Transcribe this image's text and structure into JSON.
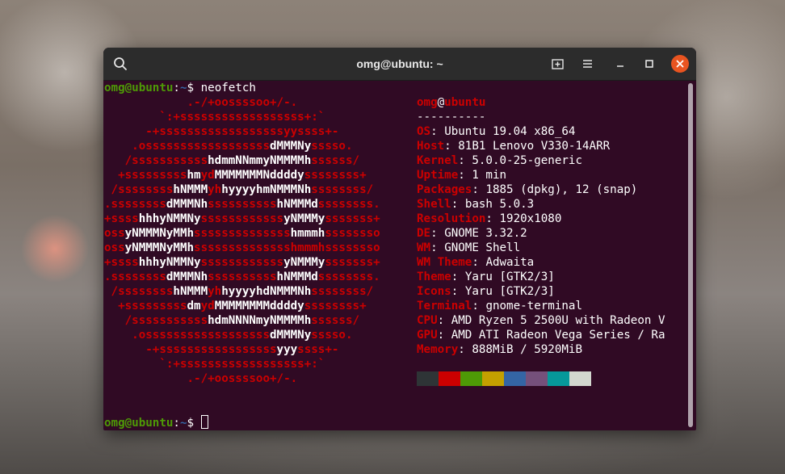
{
  "window": {
    "title": "omg@ubuntu: ~"
  },
  "colors": {
    "terminal_bg": "#300a24",
    "red": "#cc0000",
    "green": "#4e9a06",
    "blue": "#3465a4",
    "close_button": "#e95420"
  },
  "icons": {
    "search": "search-icon",
    "new_tab": "new-tab-icon",
    "menu": "hamburger-menu-icon",
    "minimize": "minimize-icon",
    "maximize": "maximize-icon",
    "close": "close-icon"
  },
  "terminal": {
    "prompt_user": "omg@ubuntu",
    "prompt_sep": ":",
    "prompt_path": "~",
    "prompt_sign": "$ ",
    "command": "neofetch",
    "ascii_art": [
      [
        [
          "r",
          "            .-/+oossssoo+/-."
        ]
      ],
      [
        [
          "r",
          "        `:+ssssssssssssssssss+:`"
        ]
      ],
      [
        [
          "r",
          "      -+ssssssssssssssssssyyssss+-"
        ]
      ],
      [
        [
          "r",
          "    .ossssssssssssssssss"
        ],
        [
          "w",
          "dMMMNy"
        ],
        [
          "r",
          "sssso."
        ]
      ],
      [
        [
          "r",
          "   /sssssssssss"
        ],
        [
          "w",
          "hdmmNNmmyNMMMMh"
        ],
        [
          "r",
          "ssssss/"
        ]
      ],
      [
        [
          "r",
          "  +sssssssss"
        ],
        [
          "w",
          "hm"
        ],
        [
          "r",
          "yd"
        ],
        [
          "w",
          "MMMMMMMNddddy"
        ],
        [
          "r",
          "ssssssss+"
        ]
      ],
      [
        [
          "r",
          " /ssssssss"
        ],
        [
          "w",
          "hNMMM"
        ],
        [
          "r",
          "yh"
        ],
        [
          "w",
          "hyyyyhmNMMMNh"
        ],
        [
          "r",
          "ssssssss/"
        ]
      ],
      [
        [
          "r",
          ".ssssssss"
        ],
        [
          "w",
          "dMMMNh"
        ],
        [
          "r",
          "ssssssssss"
        ],
        [
          "w",
          "hNMMMd"
        ],
        [
          "r",
          "ssssssss."
        ]
      ],
      [
        [
          "r",
          "+ssss"
        ],
        [
          "w",
          "hhhyNMMNy"
        ],
        [
          "r",
          "ssssssssssss"
        ],
        [
          "w",
          "yNMMMy"
        ],
        [
          "r",
          "sssssss+"
        ]
      ],
      [
        [
          "r",
          "oss"
        ],
        [
          "w",
          "yNMMMNyMMh"
        ],
        [
          "r",
          "ssssssssssssss"
        ],
        [
          "w",
          "hmmmh"
        ],
        [
          "r",
          "ssssssso"
        ]
      ],
      [
        [
          "r",
          "oss"
        ],
        [
          "w",
          "yNMMMNyMMh"
        ],
        [
          "r",
          "sssssssssssssshmmmhssssssso"
        ]
      ],
      [
        [
          "r",
          "+ssss"
        ],
        [
          "w",
          "hhhyNMMNy"
        ],
        [
          "r",
          "ssssssssssss"
        ],
        [
          "w",
          "yNMMMy"
        ],
        [
          "r",
          "sssssss+"
        ]
      ],
      [
        [
          "r",
          ".ssssssss"
        ],
        [
          "w",
          "dMMMNh"
        ],
        [
          "r",
          "ssssssssss"
        ],
        [
          "w",
          "hNMMMd"
        ],
        [
          "r",
          "ssssssss."
        ]
      ],
      [
        [
          "r",
          " /ssssssss"
        ],
        [
          "w",
          "hNMMM"
        ],
        [
          "r",
          "yh"
        ],
        [
          "w",
          "hyyyyhdNMMMNh"
        ],
        [
          "r",
          "ssssssss/"
        ]
      ],
      [
        [
          "r",
          "  +sssssssss"
        ],
        [
          "w",
          "dm"
        ],
        [
          "r",
          "yd"
        ],
        [
          "w",
          "MMMMMMMMddddy"
        ],
        [
          "r",
          "ssssssss+"
        ]
      ],
      [
        [
          "r",
          "   /sssssssssss"
        ],
        [
          "w",
          "hdmNNNNmyNMMMMh"
        ],
        [
          "r",
          "ssssss/"
        ]
      ],
      [
        [
          "r",
          "    .ossssssssssssssssss"
        ],
        [
          "w",
          "dMMMNy"
        ],
        [
          "r",
          "sssso."
        ]
      ],
      [
        [
          "r",
          "      -+sssssssssssssssss"
        ],
        [
          "w",
          "yyy"
        ],
        [
          "r",
          "ssss+-"
        ]
      ],
      [
        [
          "r",
          "        `:+ssssssssssssssssss+:`"
        ]
      ],
      [
        [
          "r",
          "            .-/+oossssoo+/-."
        ]
      ]
    ],
    "info_header_user": "omg",
    "info_header_at": "@",
    "info_header_host": "ubuntu",
    "info_divider": "----------",
    "info": [
      {
        "key": "OS",
        "value": "Ubuntu 19.04 x86_64"
      },
      {
        "key": "Host",
        "value": "81B1 Lenovo V330-14ARR"
      },
      {
        "key": "Kernel",
        "value": "5.0.0-25-generic"
      },
      {
        "key": "Uptime",
        "value": "1 min"
      },
      {
        "key": "Packages",
        "value": "1885 (dpkg), 12 (snap)"
      },
      {
        "key": "Shell",
        "value": "bash 5.0.3"
      },
      {
        "key": "Resolution",
        "value": "1920x1080"
      },
      {
        "key": "DE",
        "value": "GNOME 3.32.2"
      },
      {
        "key": "WM",
        "value": "GNOME Shell"
      },
      {
        "key": "WM Theme",
        "value": "Adwaita"
      },
      {
        "key": "Theme",
        "value": "Yaru [GTK2/3]"
      },
      {
        "key": "Icons",
        "value": "Yaru [GTK2/3]"
      },
      {
        "key": "Terminal",
        "value": "gnome-terminal"
      },
      {
        "key": "CPU",
        "value": "AMD Ryzen 5 2500U with Radeon V"
      },
      {
        "key": "GPU",
        "value": "AMD ATI Radeon Vega Series / Ra"
      },
      {
        "key": "Memory",
        "value": "888MiB / 5920MiB"
      }
    ],
    "palette": [
      "#2e3436",
      "#cc0000",
      "#4e9a06",
      "#c4a000",
      "#3465a4",
      "#75507b",
      "#06989a",
      "#d3d7cf"
    ]
  }
}
